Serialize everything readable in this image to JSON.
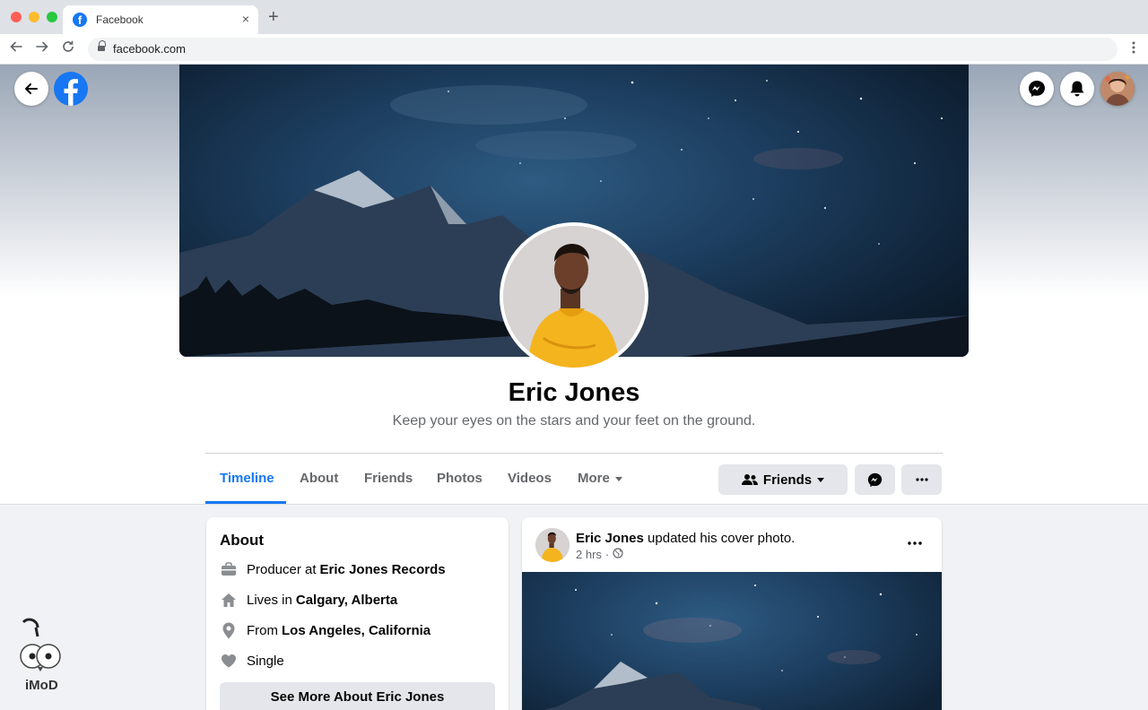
{
  "browser": {
    "tab_title": "Facebook",
    "url": "facebook.com",
    "new_tab_symbol": "+",
    "close_symbol": "×"
  },
  "profile": {
    "name": "Eric Jones",
    "bio": "Keep your eyes on the stars and your feet on the ground."
  },
  "tabs": [
    {
      "label": "Timeline",
      "active": true
    },
    {
      "label": "About"
    },
    {
      "label": "Friends"
    },
    {
      "label": "Photos"
    },
    {
      "label": "Videos"
    },
    {
      "label": "More"
    }
  ],
  "actions": {
    "friends_label": "Friends",
    "messenger_icon": "messenger-icon",
    "more_icon": "ellipsis-icon"
  },
  "about": {
    "title": "About",
    "items": [
      {
        "icon": "briefcase-icon",
        "prefix": "Producer at",
        "value": "Eric Jones Records"
      },
      {
        "icon": "home-icon",
        "prefix": "Lives in",
        "value": "Calgary, Alberta"
      },
      {
        "icon": "location-pin-icon",
        "prefix": "From",
        "value": "Los Angeles, California"
      },
      {
        "icon": "heart-icon",
        "prefix": "Single",
        "value": ""
      }
    ],
    "see_more": "See More About Eric Jones"
  },
  "post": {
    "author": "Eric Jones",
    "action": "updated his cover photo.",
    "time": "2 hrs",
    "separator": "·",
    "audience_icon": "globe-icon"
  },
  "watermark": {
    "text": "iMoD"
  },
  "colors": {
    "brand": "#1877f2",
    "secondary_text": "#65676b",
    "button_bg": "#e4e6eb",
    "page_bg": "#f0f2f5"
  }
}
